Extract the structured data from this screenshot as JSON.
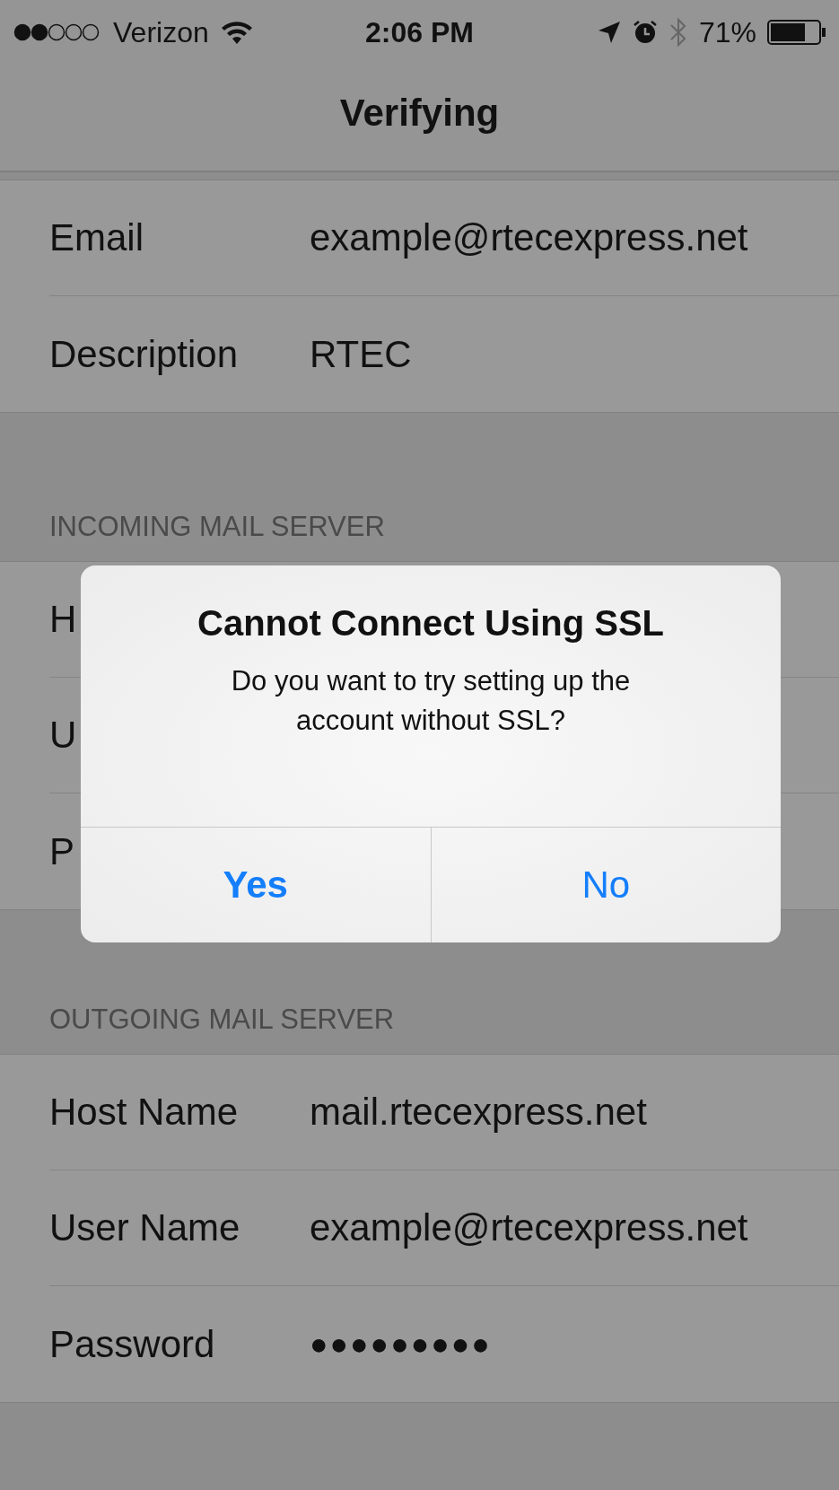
{
  "status_bar": {
    "carrier": "Verizon",
    "time": "2:06 PM",
    "battery": "71%"
  },
  "nav_bar": {
    "title": "Verifying"
  },
  "sections": [
    {
      "rows": [
        {
          "label": "Email",
          "value": "example@rtecexpress.net"
        },
        {
          "label": "Description",
          "value": "RTEC"
        }
      ]
    },
    {
      "header": "INCOMING MAIL SERVER",
      "rows": [
        {
          "label": "H"
        },
        {
          "label": "U"
        },
        {
          "label": "P"
        }
      ]
    },
    {
      "header": "OUTGOING MAIL SERVER",
      "rows": [
        {
          "label": "Host Name",
          "value": "mail.rtecexpress.net"
        },
        {
          "label": "User Name",
          "value": "example@rtecexpress.net"
        },
        {
          "label": "Password",
          "value": "●●●●●●●●●",
          "kind": "secure"
        }
      ]
    }
  ],
  "alert": {
    "title": "Cannot Connect Using SSL",
    "message": "Do you want to try setting up the account without SSL?",
    "buttons": [
      {
        "label": "Yes",
        "bold": true
      },
      {
        "label": "No",
        "bold": false
      }
    ]
  }
}
